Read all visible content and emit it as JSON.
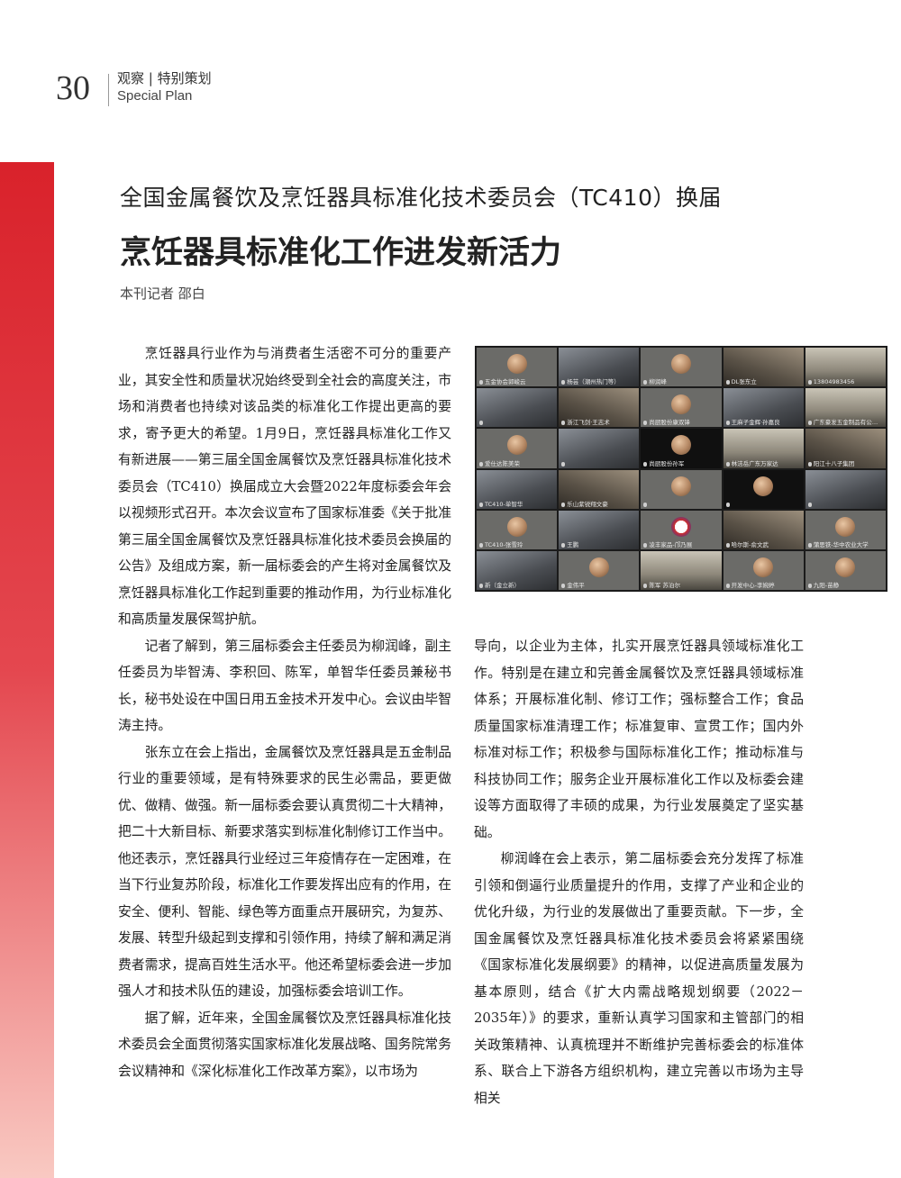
{
  "header": {
    "page_number": "30",
    "section_cn": "观察 | 特别策划",
    "section_en": "Special Plan"
  },
  "article": {
    "subtitle": "全国金属餐饮及烹饪器具标准化技术委员会（TC410）换届",
    "title": "烹饪器具标准化工作进发新活力",
    "byline": "本刊记者 邵白",
    "left_column": [
      "烹饪器具行业作为与消费者生活密不可分的重要产业，其安全性和质量状况始终受到全社会的高度关注，市场和消费者也持续对该品类的标准化工作提出更高的要求，寄予更大的希望。1月9日，烹饪器具标准化工作又有新进展——第三届全国金属餐饮及烹饪器具标准化技术委员会（TC410）换届成立大会暨2022年度标委会年会以视频形式召开。本次会议宣布了国家标准委《关于批准第三届全国金属餐饮及烹饪器具标准化技术委员会换届的公告》及组成方案，新一届标委会的产生将对金属餐饮及烹饪器具标准化工作起到重要的推动作用，为行业标准化和高质量发展保驾护航。",
      "记者了解到，第三届标委会主任委员为柳润峰，副主任委员为毕智涛、李积回、陈军，单智华任委员兼秘书长，秘书处设在中国日用五金技术开发中心。会议由毕智涛主持。",
      "张东立在会上指出，金属餐饮及烹饪器具是五金制品行业的重要领域，是有特殊要求的民生必需品，要更做优、做精、做强。新一届标委会要认真贯彻二十大精神，把二十大新目标、新要求落实到标准化制修订工作当中。他还表示，烹饪器具行业经过三年疫情存在一定困难，在当下行业复苏阶段，标准化工作要发挥出应有的作用，在安全、便利、智能、绿色等方面重点开展研究，为复苏、发展、转型升级起到支撑和引领作用，持续了解和满足消费者需求，提高百姓生活水平。他还希望标委会进一步加强人才和技术队伍的建设，加强标委会培训工作。",
      "据了解，近年来，全国金属餐饮及烹饪器具标准化技术委员会全面贯彻落实国家标准化发展战略、国务院常务会议精神和《深化标准化工作改革方案》，以市场为"
    ],
    "right_column": [
      "导向，以企业为主体，扎实开展烹饪器具领域标准化工作。特别是在建立和完善金属餐饮及烹饪器具领域标准体系；开展标准化制、修订工作；强标整合工作；食品质量国家标准清理工作；标准复审、宣贯工作；国内外标准对标工作；积极参与国际标准化工作；推动标准与科技协同工作；服务企业开展标准化工作以及标委会建设等方面取得了丰硕的成果，为行业发展奠定了坚实基础。",
      "柳润峰在会上表示，第二届标委会充分发挥了标准引领和倒逼行业质量提升的作用，支撑了产业和企业的优化升级，为行业的发展做出了重要贡献。下一步，全国金属餐饮及烹饪器具标准化技术委员会将紧紧围绕《国家标准化发展纲要》的精神，以促进高质量发展为基本原则，结合《扩大内需战略规划纲要（2022－2035年）》的要求，重新认真学习国家和主管部门的相关政策精神、认真梳理并不断维护完善标委会的标准体系、联合上下游各方组织机构，建立完善以市场为主导相关"
    ]
  },
  "video_tiles": [
    {
      "label": "五金协会郭峻云",
      "style": "light"
    },
    {
      "label": "杨芸（潮州热门等）",
      "style": "photo"
    },
    {
      "label": "柳润峰",
      "style": "light"
    },
    {
      "label": "DL张东立",
      "style": "photo2"
    },
    {
      "label": "13804983456",
      "style": "photo3"
    },
    {
      "label": "",
      "style": "photo"
    },
    {
      "label": "浙江飞剑·王志术",
      "style": "photo2"
    },
    {
      "label": "尚厨股份康双锋",
      "style": "light"
    },
    {
      "label": "王麻子金辉·孙嘉良",
      "style": "photo"
    },
    {
      "label": "广东豪发五金制品有公…",
      "style": "photo3"
    },
    {
      "label": "爱仕达陈美荣",
      "style": "light"
    },
    {
      "label": "",
      "style": "photo"
    },
    {
      "label": "尚厨股份孙军",
      "style": "dark"
    },
    {
      "label": "林洁岳广东万家达",
      "style": "photo3"
    },
    {
      "label": "阳江十八子集团",
      "style": "photo2"
    },
    {
      "label": "TC410-单智华",
      "style": "photo"
    },
    {
      "label": "乐山紫锐翔文豪",
      "style": "photo2"
    },
    {
      "label": "",
      "style": "light"
    },
    {
      "label": "",
      "style": "dark"
    },
    {
      "label": "",
      "style": "photo"
    },
    {
      "label": "TC410-张雪玲",
      "style": "light"
    },
    {
      "label": "王鹏",
      "style": "photo"
    },
    {
      "label": "凌丰家品-邝乃展",
      "style": "light"
    },
    {
      "label": "哈尔斯-俞文武",
      "style": "photo2"
    },
    {
      "label": "蒲思铁-华中农业大学",
      "style": "light"
    },
    {
      "label": "新（金立新）",
      "style": "photo"
    },
    {
      "label": "金伟平",
      "style": "light"
    },
    {
      "label": "陈军 苏泊尔",
      "style": "photo3"
    },
    {
      "label": "开发中心-李婉婷",
      "style": "light"
    },
    {
      "label": "九阳-苗静",
      "style": "light"
    }
  ]
}
